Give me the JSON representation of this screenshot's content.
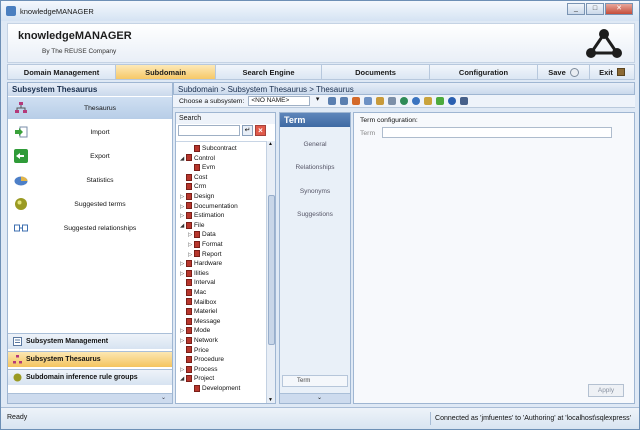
{
  "window": {
    "title": "knowledgeMANAGER"
  },
  "window_controls": {
    "minimize": "_",
    "maximize": "□",
    "close": "✕"
  },
  "header": {
    "app_name": "knowledgeMANAGER",
    "company": "By The REUSE Company"
  },
  "menu": {
    "items": [
      "Domain Management",
      "Subdomain",
      "Search Engine",
      "Documents",
      "Configuration"
    ],
    "active": "Subdomain",
    "save": "Save",
    "exit": "Exit"
  },
  "left_panel": {
    "title": "Subsystem Thesaurus",
    "items": [
      {
        "label": "Thesaurus",
        "icon": "thesaurus-icon"
      },
      {
        "label": "Import",
        "icon": "import-icon"
      },
      {
        "label": "Export",
        "icon": "export-icon"
      },
      {
        "label": "Statistics",
        "icon": "statistics-icon"
      },
      {
        "label": "Suggested terms",
        "icon": "suggested-terms-icon"
      },
      {
        "label": "Suggested relationships",
        "icon": "suggested-relationships-icon"
      }
    ],
    "sections": [
      "Subsystem Management",
      "Subsystem Thesaurus",
      "Subdomain inference rule groups"
    ],
    "active_section": "Subsystem Thesaurus"
  },
  "breadcrumb": "Subdomain > Subsystem Thesaurus > Thesaurus",
  "toolbar": {
    "label": "Choose a subsystem:",
    "selected": "<NO NAME>"
  },
  "search": {
    "title": "Search",
    "tree": [
      {
        "label": "Subcontract",
        "level": 1,
        "expander": ""
      },
      {
        "label": "Control",
        "level": 0,
        "expander": "◢"
      },
      {
        "label": "Evm",
        "level": 1,
        "expander": ""
      },
      {
        "label": "Cost",
        "level": 0,
        "expander": ""
      },
      {
        "label": "Crm",
        "level": 0,
        "expander": ""
      },
      {
        "label": "Design",
        "level": 0,
        "expander": "▷"
      },
      {
        "label": "Documentation",
        "level": 0,
        "expander": "▷"
      },
      {
        "label": "Estimation",
        "level": 0,
        "expander": "▷"
      },
      {
        "label": "File",
        "level": 0,
        "expander": "◢"
      },
      {
        "label": "Data",
        "level": 1,
        "expander": "▷"
      },
      {
        "label": "Format",
        "level": 1,
        "expander": "▷"
      },
      {
        "label": "Report",
        "level": 1,
        "expander": "▷"
      },
      {
        "label": "Hardware",
        "level": 0,
        "expander": "▷"
      },
      {
        "label": "Ilities",
        "level": 0,
        "expander": "▷"
      },
      {
        "label": "Interval",
        "level": 0,
        "expander": ""
      },
      {
        "label": "Mac",
        "level": 0,
        "expander": ""
      },
      {
        "label": "Mailbox",
        "level": 0,
        "expander": ""
      },
      {
        "label": "Materiel",
        "level": 0,
        "expander": ""
      },
      {
        "label": "Message",
        "level": 0,
        "expander": ""
      },
      {
        "label": "Mode",
        "level": 0,
        "expander": "▷"
      },
      {
        "label": "Network",
        "level": 0,
        "expander": "▷"
      },
      {
        "label": "Price",
        "level": 0,
        "expander": ""
      },
      {
        "label": "Procedure",
        "level": 0,
        "expander": ""
      },
      {
        "label": "Process",
        "level": 0,
        "expander": "▷"
      },
      {
        "label": "Project",
        "level": 0,
        "expander": "◢"
      },
      {
        "label": "Development",
        "level": 1,
        "expander": ""
      }
    ]
  },
  "term_panel": {
    "title": "Term",
    "tabs": [
      "General",
      "Relationships",
      "Synonyms",
      "Suggestions"
    ],
    "pinned": "Term"
  },
  "config": {
    "title": "Term configuration:",
    "term_label": "Term",
    "apply": "Apply"
  },
  "status": {
    "left": "Ready",
    "right": "Connected as 'jmfuentes' to 'Authoring' at 'localhost\\sqlexpress'"
  }
}
